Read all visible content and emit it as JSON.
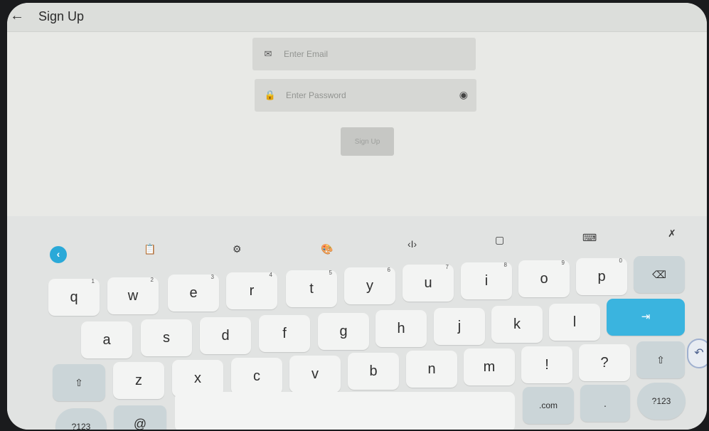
{
  "header": {
    "back_icon": "arrow-left-icon",
    "title": "Sign Up"
  },
  "form": {
    "email": {
      "icon": "envelope-icon",
      "placeholder": "Enter Email",
      "value": ""
    },
    "password": {
      "icon": "lock-icon",
      "placeholder": "Enter Password",
      "value": "",
      "toggle_icon": "eye-icon"
    },
    "submit_label": "Sign Up"
  },
  "keyboard": {
    "toolbar": [
      "chevron-left-icon",
      "clipboard-icon",
      "gear-icon",
      "palette-icon",
      "text-cursor-icon",
      "translate-icon",
      "keyboard-icon",
      "mic-off-icon"
    ],
    "row1": [
      {
        "label": "q",
        "hint": "1"
      },
      {
        "label": "w",
        "hint": "2"
      },
      {
        "label": "e",
        "hint": "3"
      },
      {
        "label": "r",
        "hint": "4"
      },
      {
        "label": "t",
        "hint": "5"
      },
      {
        "label": "y",
        "hint": "6"
      },
      {
        "label": "u",
        "hint": "7"
      },
      {
        "label": "i",
        "hint": "8"
      },
      {
        "label": "o",
        "hint": "9"
      },
      {
        "label": "p",
        "hint": "0"
      }
    ],
    "backspace_icon": "backspace-icon",
    "row2": [
      "a",
      "s",
      "d",
      "f",
      "g",
      "h",
      "j",
      "k",
      "l"
    ],
    "tab_icon": "tab-arrow-icon",
    "row3": [
      "z",
      "x",
      "c",
      "v",
      "b",
      "n",
      "m",
      "!",
      "?"
    ],
    "shift_icon": "shift-icon",
    "row4": {
      "symbols": "?123",
      "at": "@",
      "com": ".com",
      "dot": ".",
      "symbols_right": "?123"
    },
    "edge_icon": "undo-icon"
  },
  "colors": {
    "accent": "#3ab4df",
    "screen_bg": "#e8e9e6",
    "key_bg": "#f3f4f3",
    "function_key_bg": "#cbd5d8"
  }
}
